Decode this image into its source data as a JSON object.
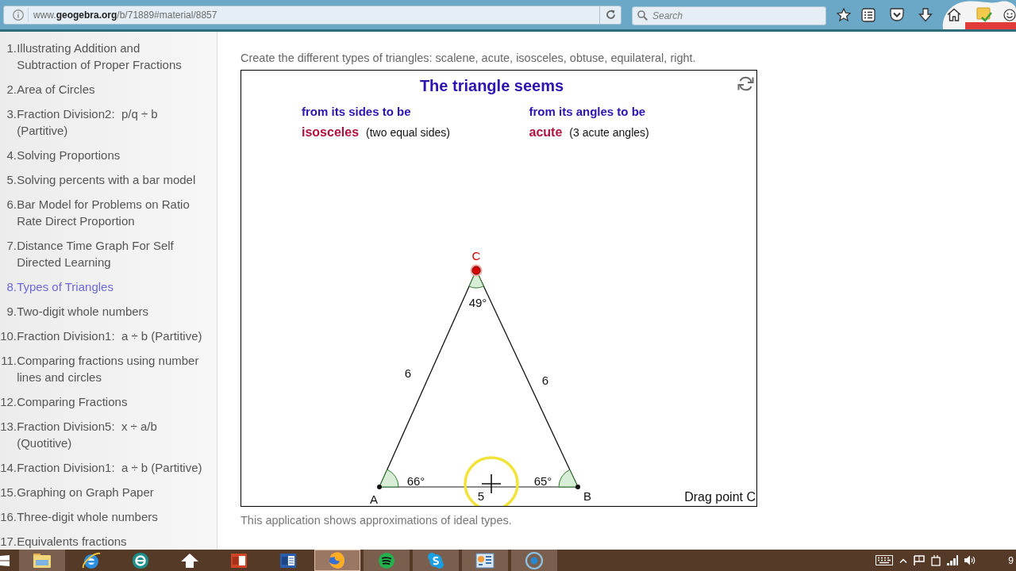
{
  "address_bar": {
    "value": "www.**geogebra.org**/b/71889#material/8857"
  },
  "search": {
    "placeholder": "Search"
  },
  "sidebar": {
    "items": [
      {
        "number": "1.",
        "label": "Illustrating Addition and\nSubtraction of Proper Fractions",
        "selected": false
      },
      {
        "number": "2.",
        "label": "Area of Circles",
        "selected": false
      },
      {
        "number": "3.",
        "label": "Fraction Division2:  p/q ÷ b\n(Partitive)",
        "selected": false
      },
      {
        "number": "4.",
        "label": "Solving Proportions",
        "selected": false
      },
      {
        "number": "5.",
        "label": "Solving percents with a bar model",
        "selected": false
      },
      {
        "number": "6.",
        "label": "Bar Model for Problems on Ratio\nRate Direct Proportion",
        "selected": false
      },
      {
        "number": "7.",
        "label": "Distance Time Graph For Self\nDirected Learning",
        "selected": false
      },
      {
        "number": "8.",
        "label": "Types of Triangles",
        "selected": true
      },
      {
        "number": "9.",
        "label": "Two-digit whole numbers",
        "selected": false
      },
      {
        "number": "10.",
        "label": "Fraction Division1:  a ÷ b (Partitive)",
        "selected": false
      },
      {
        "number": "11.",
        "label": "Comparing fractions using number\nlines and circles",
        "selected": false
      },
      {
        "number": "12.",
        "label": "Comparing Fractions",
        "selected": false
      },
      {
        "number": "13.",
        "label": "Fraction Division5:  x ÷ a/b\n(Quotitive)",
        "selected": false
      },
      {
        "number": "14.",
        "label": "Fraction Division1:  a ÷ b (Partitive)",
        "selected": false
      },
      {
        "number": "15.",
        "label": "Graphing on Graph Paper",
        "selected": false
      },
      {
        "number": "16.",
        "label": "Three-digit whole numbers",
        "selected": false
      },
      {
        "number": "17.",
        "label": "Equivalents fractions",
        "selected": false
      }
    ]
  },
  "content": {
    "intro": "Create the different types of triangles: scalene, acute, isosceles, obtuse, equilateral, right.",
    "footnote": "This application shows approximations of ideal types."
  },
  "applet": {
    "title": "The triangle seems",
    "columns": [
      {
        "heading": "from its sides to be",
        "result": "isosceles",
        "note": "(two equal sides)"
      },
      {
        "heading": "from its angles to be",
        "result": "acute",
        "note": "(3 acute angles)"
      }
    ],
    "points": [
      {
        "label": "A",
        "kind": "fixed"
      },
      {
        "label": "B",
        "kind": "fixed"
      },
      {
        "label": "C",
        "kind": "free"
      }
    ],
    "sides": [
      {
        "label": "6"
      },
      {
        "label": "6"
      },
      {
        "label": "5"
      }
    ],
    "angles": [
      {
        "label": "66°"
      },
      {
        "label": "65°"
      },
      {
        "label": "49°"
      }
    ],
    "hint": "Drag point C"
  },
  "taskbar": {
    "apps": [
      {
        "running": true,
        "selected": false
      },
      {
        "running": false,
        "selected": false
      },
      {
        "running": false,
        "selected": false
      },
      {
        "running": false,
        "selected": false
      },
      {
        "running": false,
        "selected": false
      },
      {
        "running": false,
        "selected": false
      },
      {
        "running": true,
        "selected": true
      },
      {
        "running": true,
        "selected": false
      },
      {
        "running": true,
        "selected": false
      },
      {
        "running": true,
        "selected": false
      },
      {
        "running": true,
        "selected": false
      }
    ],
    "clock": "9"
  }
}
